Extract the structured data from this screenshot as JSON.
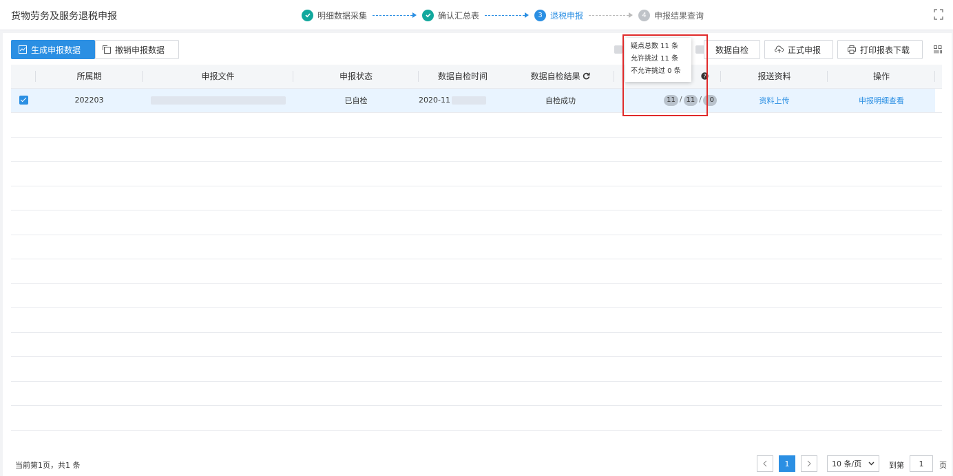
{
  "app": {
    "title": "货物劳务及服务退税申报"
  },
  "steps": [
    {
      "label": "明细数据采集",
      "state": "done"
    },
    {
      "label": "确认汇总表",
      "state": "done"
    },
    {
      "label": "退税申报",
      "number": "3",
      "state": "active"
    },
    {
      "label": "申报结果查询",
      "number": "4",
      "state": "pending"
    }
  ],
  "toolbar": {
    "generate": "生成申报数据",
    "cancel": "撤销申报数据",
    "self_check": "数据自检",
    "formal": "正式申报",
    "print": "打印报表下载"
  },
  "tooltip": {
    "line1": "疑点总数 11 条",
    "line2": "允许挑过 11 条",
    "line3": "不允许挑过 0 条"
  },
  "table": {
    "headers": [
      "所属期",
      "申报文件",
      "申报状态",
      "数据自检时间",
      "数据自检结果",
      "",
      "报送资料",
      "操作"
    ],
    "rows": [
      {
        "period": "202203",
        "status": "已自检",
        "check_time": "2020-11",
        "check_result": "自检成功",
        "doubt_total": "11",
        "doubt_allowed": "11",
        "doubt_denied": "0",
        "upload": "资料上传",
        "action": "申报明细查看"
      }
    ]
  },
  "footer": {
    "info": "当前第1页，共1 条",
    "page": "1",
    "page_size": "10 条/页",
    "goto_label": "到第",
    "goto_value": "1",
    "page_suffix": "页"
  },
  "colors": {
    "accent": "#2b8fe3",
    "done": "#12a89d",
    "highlight": "#e02a2a"
  }
}
